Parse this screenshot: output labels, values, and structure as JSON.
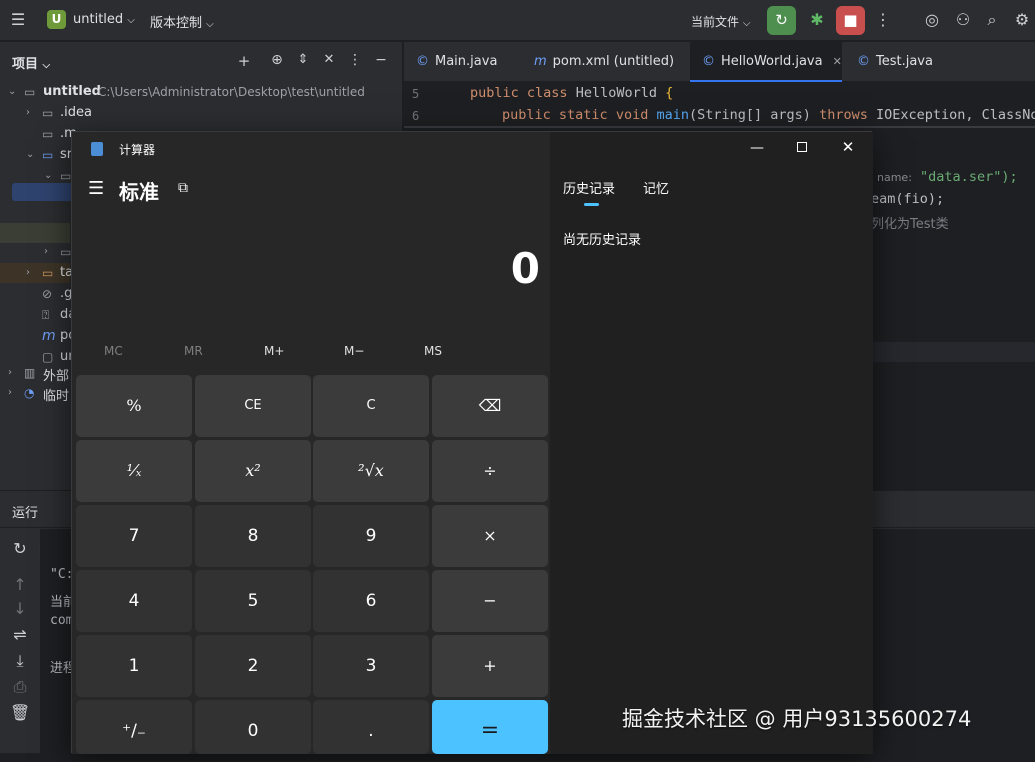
{
  "titlebar": {
    "project_badge": "U",
    "project_name": "untitled",
    "vcs": "版本控制",
    "run_config": "当前文件"
  },
  "project_panel": {
    "title": "项目",
    "root_name": "untitled",
    "root_path": "C:\\Users\\Administrator\\Desktop\\test\\untitled",
    "items": [
      ".idea",
      ".m",
      "sr",
      "",
      "",
      "",
      "ta",
      ".g",
      "da",
      "po",
      "ur",
      "外部",
      "临时"
    ]
  },
  "editor": {
    "tabs": [
      "Main.java",
      "pom.xml (untitled)",
      "HelloWorld.java",
      "Test.java"
    ],
    "line_numbers": [
      "5",
      "6"
    ],
    "lines": {
      "l5_kw1": "public",
      "l5_kw2": "class",
      "l5_name": "HelloWorld",
      "l5_brace": "{",
      "l6_kw1": "public",
      "l6_kw2": "static",
      "l6_kw3": "void",
      "l6_fn": "main",
      "l6_args": "(String[] args)",
      "l6_throws": "throws",
      "l6_rest": "IOException, ClassNot",
      "hint_name": "name:",
      "str_data": "\"data.ser\");",
      "eam": "eam(fio);",
      "comment": "列化为Test类"
    }
  },
  "bottom_panel": {
    "tab_run": "运行",
    "console": [
      "\"C:",
      "当前",
      "com",
      "进程"
    ]
  },
  "calculator": {
    "window_title": "计算器",
    "mode": "标准",
    "display": "0",
    "memory": [
      "MC",
      "MR",
      "M+",
      "M−",
      "MS"
    ],
    "keys": [
      "%",
      "CE",
      "C",
      "⌫",
      "¹⁄ₓ",
      "x²",
      "²√x",
      "÷",
      "7",
      "8",
      "9",
      "×",
      "4",
      "5",
      "6",
      "−",
      "1",
      "2",
      "3",
      "+",
      "⁺∕₋",
      "0",
      ".",
      "="
    ],
    "tab_history": "历史记录",
    "tab_memory": "记忆",
    "history_empty": "尚无历史记录"
  },
  "watermark": "掘金技术社区 @ 用户93135600274",
  "colors": {
    "accent": "#4cc2ff",
    "ide_bg": "#1e1f22",
    "panel_bg": "#2b2d30"
  }
}
